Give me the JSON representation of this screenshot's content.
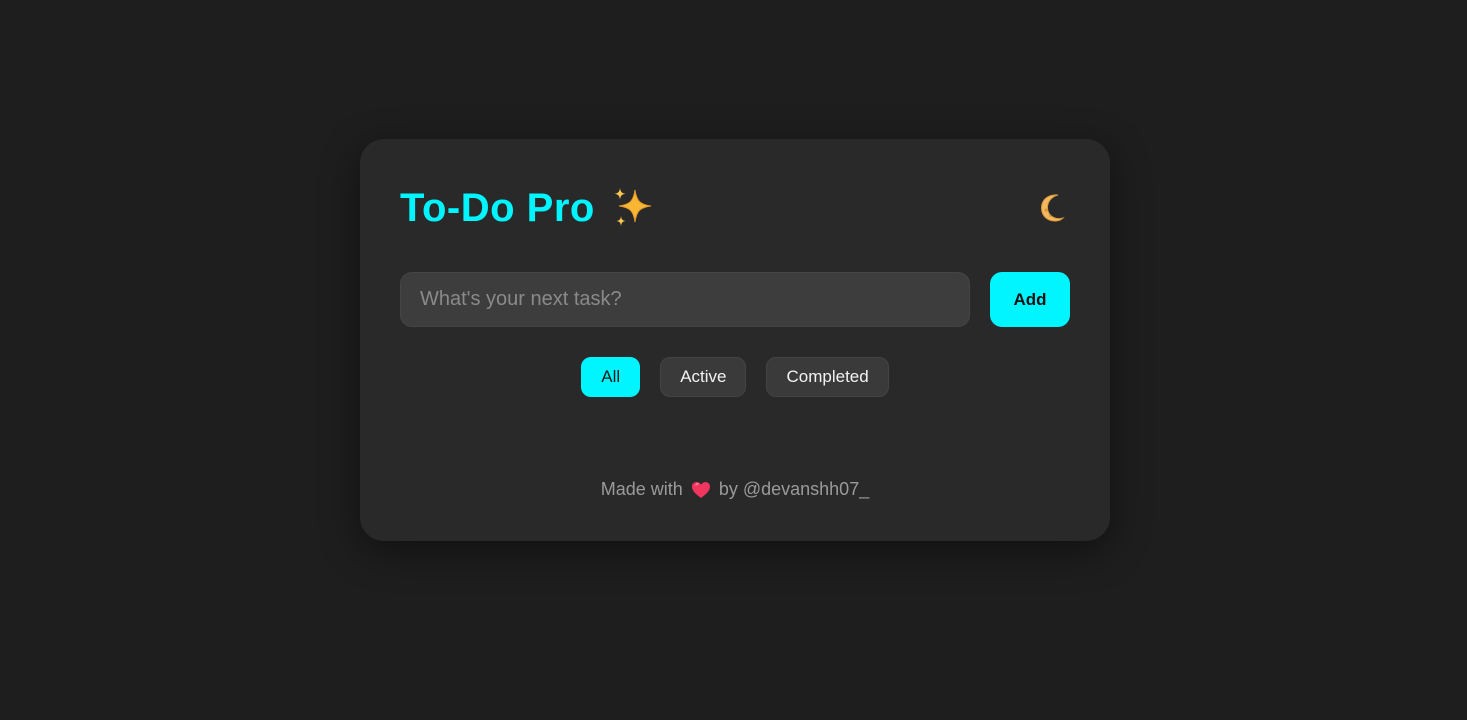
{
  "app": {
    "title": "To-Do Pro",
    "title_icon": "sparkles-icon",
    "theme_toggle_icon": "moon-icon",
    "accent_color": "#00f5ff",
    "background_color": "#1e1e1e",
    "card_color": "#292929"
  },
  "task_input": {
    "placeholder": "What's your next task?",
    "value": ""
  },
  "add_button": {
    "label": "Add"
  },
  "filters": [
    {
      "label": "All",
      "active": true
    },
    {
      "label": "Active",
      "active": false
    },
    {
      "label": "Completed",
      "active": false
    }
  ],
  "footer": {
    "prefix": "Made with",
    "icon": "heart-icon",
    "suffix": "by @devanshh07_"
  }
}
